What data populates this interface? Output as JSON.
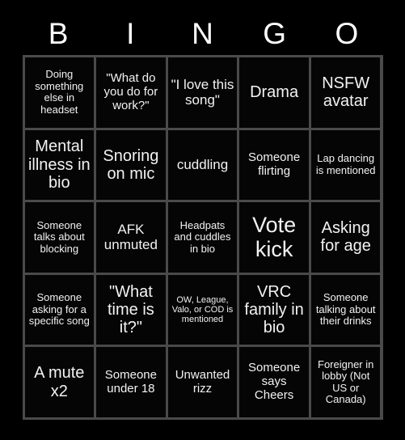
{
  "header": {
    "letters": [
      "B",
      "I",
      "N",
      "G",
      "O"
    ]
  },
  "colors": {
    "background": "#000000",
    "cell_background": "#050505",
    "gridline": "#4a4a4a",
    "text": "#f2f2f2"
  },
  "grid": {
    "rows": 5,
    "columns": 5,
    "cells": [
      {
        "text": "Doing something else in headset",
        "size": "sm"
      },
      {
        "text": "\"What do you do for work?\"",
        "size": "md"
      },
      {
        "text": "\"I love this song\"",
        "size": "lg"
      },
      {
        "text": "Drama",
        "size": "xl"
      },
      {
        "text": "NSFW avatar",
        "size": "xl"
      },
      {
        "text": "Mental illness in bio",
        "size": "xl"
      },
      {
        "text": "Snoring on mic",
        "size": "xl"
      },
      {
        "text": "cuddling",
        "size": "lg"
      },
      {
        "text": "Someone flirting",
        "size": "md"
      },
      {
        "text": "Lap dancing is mentioned",
        "size": "sm"
      },
      {
        "text": "Someone talks about blocking",
        "size": "sm"
      },
      {
        "text": "AFK unmuted",
        "size": "lg"
      },
      {
        "text": "Headpats and cuddles in bio",
        "size": "sm"
      },
      {
        "text": "Vote kick",
        "size": "xxl"
      },
      {
        "text": "Asking for age",
        "size": "xl"
      },
      {
        "text": "Someone asking for a specific song",
        "size": "sm"
      },
      {
        "text": "\"What time is it?\"",
        "size": "xl"
      },
      {
        "text": "OW, League, Valo, or COD is mentioned",
        "size": "xs"
      },
      {
        "text": "VRC family in bio",
        "size": "xl"
      },
      {
        "text": "Someone talking about their drinks",
        "size": "sm"
      },
      {
        "text": "A mute x2",
        "size": "xl"
      },
      {
        "text": "Someone under 18",
        "size": "md"
      },
      {
        "text": "Unwanted rizz",
        "size": "md"
      },
      {
        "text": "Someone says Cheers",
        "size": "md"
      },
      {
        "text": "Foreigner in lobby (Not US or Canada)",
        "size": "sm"
      }
    ]
  }
}
